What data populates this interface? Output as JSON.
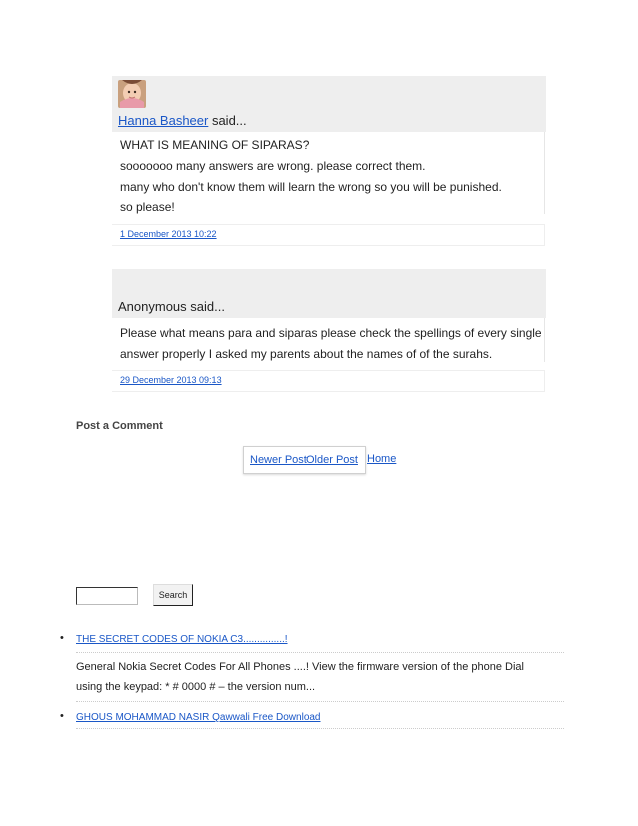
{
  "comments": [
    {
      "author": "Hanna Basheer",
      "said": " said...",
      "lines": [
        "WHAT IS MEANING OF SIPARAS?",
        "sooooooo many answers are wrong. please correct them.",
        "many who don't know them will learn the wrong so you will be punished.",
        "so please!"
      ],
      "date": "1 December 2013 10:22"
    },
    {
      "author": "Anonymous said...",
      "lines": [
        "Please what means para and siparas please check the spellings of every single",
        "answer properly I asked my parents about the names of of the surahs."
      ],
      "date": "29 December 2013 09:13"
    }
  ],
  "post_comment": "Post a Comment",
  "pager": {
    "newer": "Newer Post",
    "older": "Older Post",
    "home": "Home"
  },
  "search": {
    "value": "",
    "button_label": "Search"
  },
  "popular_posts": [
    {
      "bullet": "•",
      "title": "THE SECRET CODES OF NOKIA C3...............!",
      "snippet": "General Nokia Secret Codes For All Phones ....! View the firmware version of the phone Dial using the keypad: * # 0000 # – the version num..."
    },
    {
      "bullet": "•",
      "title": "GHOUS MOHAMMAD NASIR Qawwali Free Download"
    }
  ],
  "colors": {
    "link": "#1a57c7",
    "comment_header_bg": "#eeeeee"
  },
  "icons": {
    "avatar": "baby-photo-avatar"
  }
}
